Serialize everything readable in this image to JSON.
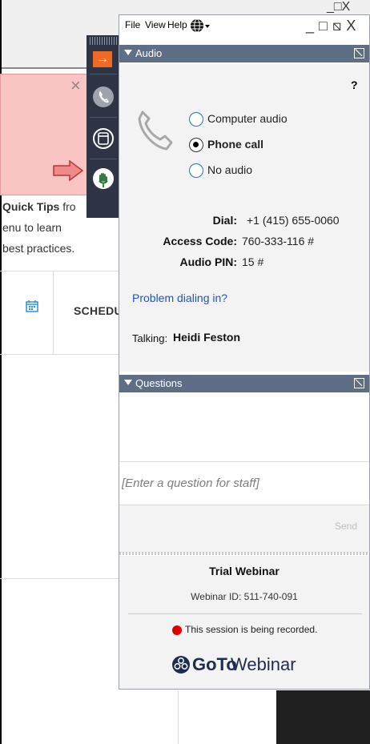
{
  "background": {
    "close_glyph": "×",
    "tips_bold": "Quick Tips",
    "tips_rest": " fro",
    "line2": "enu to learn",
    "line3": "best practices.",
    "schedule": "SCHEDU"
  },
  "menu": {
    "file": "File",
    "view": "View",
    "help": "Help",
    "window_controls": "_□⧅X"
  },
  "audio": {
    "section_label": "Audio",
    "help_glyph": "?",
    "options": [
      {
        "label": "Computer audio",
        "selected": false
      },
      {
        "label": "Phone call",
        "selected": true
      },
      {
        "label": "No audio",
        "selected": false
      }
    ],
    "dial_label": "Dial:",
    "dial_value": "+1 (415) 655-0060",
    "access_label": "Access Code:",
    "access_value": "760-333-116 #",
    "pin_label": "Audio PIN:",
    "pin_value": "15 #",
    "problem_link": "Problem dialing in?",
    "talking_label": "Talking:",
    "talking_name": "Heidi Feston"
  },
  "questions": {
    "section_label": "Questions",
    "placeholder": "[Enter a question for staff]",
    "send_label": "Send"
  },
  "footer": {
    "title": "Trial Webinar",
    "webinar_id": "Webinar ID: 511-740-091",
    "recording": "This session is being recorded.",
    "logo_bold": "GoTo",
    "logo_light": "Webinar"
  },
  "colors": {
    "section_header": "#5f6e87",
    "toolbar": "#2e3444",
    "toolbar_accent": "#f16a24",
    "link": "#2454b8",
    "recording": "#dd0000"
  }
}
